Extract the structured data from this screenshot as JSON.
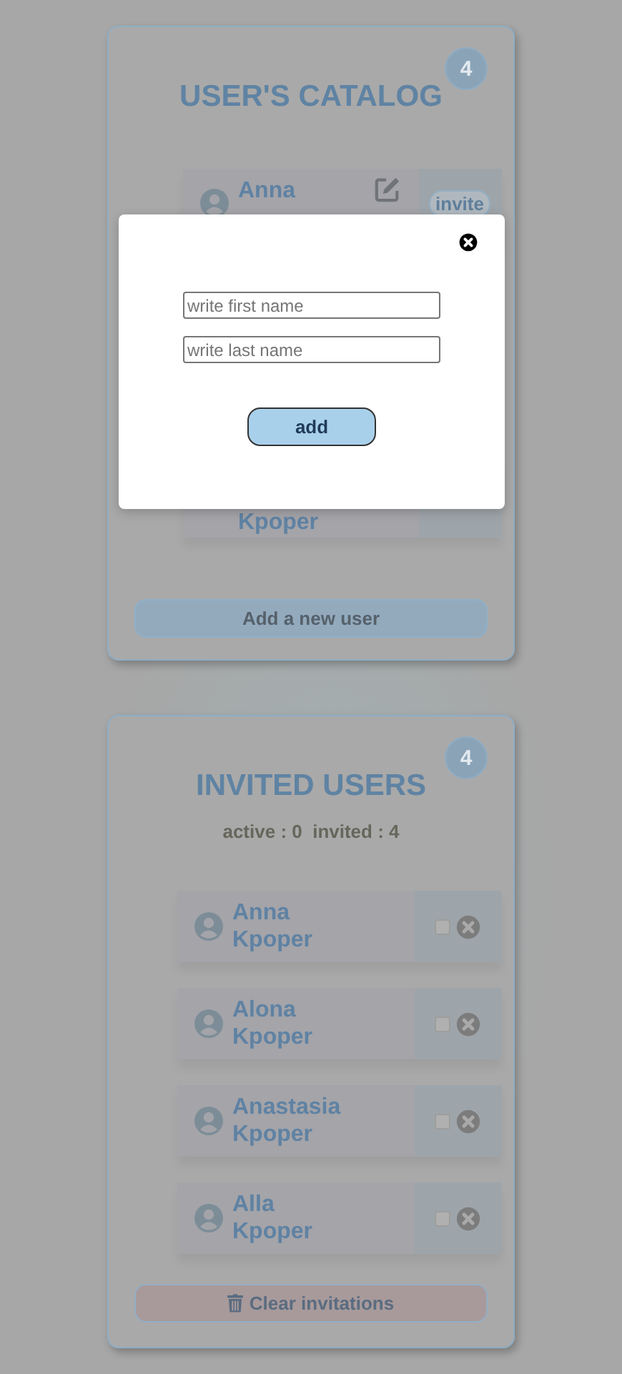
{
  "catalog": {
    "title": "USER'S CATALOG",
    "count": "4",
    "users": [
      {
        "first_name": "Anna",
        "action": "invite"
      },
      {
        "last_name": "Kpoper"
      }
    ],
    "add_button": "Add a new user"
  },
  "invited": {
    "title": "INVITED USERS",
    "count": "4",
    "stats": "active : 0  invited : 4",
    "users": [
      {
        "first_name": "Anna",
        "last_name": "Kpoper",
        "checked": false
      },
      {
        "first_name": "Alona",
        "last_name": "Kpoper",
        "checked": false
      },
      {
        "first_name": "Anastasia",
        "last_name": "Kpoper",
        "checked": false
      },
      {
        "first_name": "Alla",
        "last_name": "Kpoper",
        "checked": false
      }
    ],
    "clear_button": "Clear invitations"
  },
  "modal": {
    "fields": [
      {
        "placeholder": "write first name"
      },
      {
        "placeholder": "write last name"
      }
    ],
    "submit": "add"
  }
}
